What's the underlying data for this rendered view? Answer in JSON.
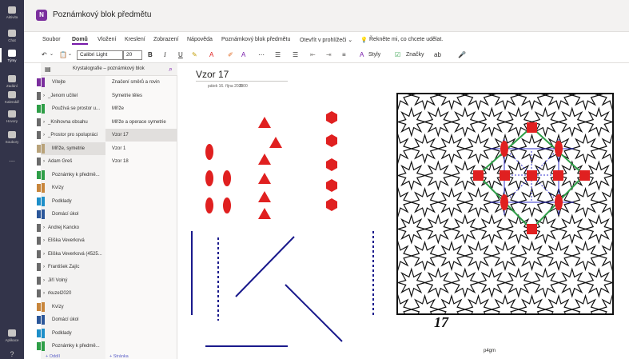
{
  "rail": [
    {
      "label": "Aktivita",
      "icon": "bell-icon"
    },
    {
      "label": "Chat",
      "icon": "chat-icon"
    },
    {
      "label": "Týmy",
      "icon": "teams-icon",
      "active": true
    },
    {
      "label": "Zadání",
      "icon": "assignments-icon"
    },
    {
      "label": "Kalendář",
      "icon": "calendar-icon"
    },
    {
      "label": "Hovory",
      "icon": "phone-icon"
    },
    {
      "label": "Soubory",
      "icon": "files-icon"
    },
    {
      "label": "...",
      "icon": "more-icon"
    },
    {
      "label": "Aplikace",
      "icon": "apps-icon"
    },
    {
      "label": "?",
      "icon": "help-icon"
    }
  ],
  "app": {
    "icon_letter": "N",
    "title": "Poznámkový blok předmětu"
  },
  "menu": [
    "Soubor",
    "Domů",
    "Vložení",
    "Kreslení",
    "Zobrazení",
    "Nápověda",
    "Poznámkový blok předmětu",
    "Otevřít v prohlížeči",
    "Řekněte mi, co chcete udělat."
  ],
  "toolbar": {
    "font": "Calibri Light",
    "size": "20",
    "bold": "B",
    "italic": "I",
    "underline": "U",
    "styles": "Styly",
    "tags": "Značky"
  },
  "notebook": {
    "title": "Krystalografie – poznámkový blok"
  },
  "sections": [
    {
      "label": "Vítejte",
      "color": "#7b2f9e"
    },
    {
      "label": "_Jenom učitel",
      "color": "",
      "group": true
    },
    {
      "label": "Používá se prostor u...",
      "color": "#2e9e47"
    },
    {
      "label": "_Knihovna obsahu",
      "color": "",
      "group": true
    },
    {
      "label": "_Prostor pro spolupráci",
      "color": "",
      "group": true
    },
    {
      "label": "Mříže, symetrie",
      "color": "#b9a37a",
      "active": true
    },
    {
      "label": "Adam Greš",
      "color": "",
      "group": true
    },
    {
      "label": "Poznámky k předmě...",
      "color": "#2e9e47"
    },
    {
      "label": "Kvízy",
      "color": "#c8863c"
    },
    {
      "label": "Podklady",
      "color": "#1e8fc9"
    },
    {
      "label": "Domácí úkol",
      "color": "#2b579a"
    },
    {
      "label": "Andrej Kancko",
      "color": "",
      "group": true
    },
    {
      "label": "Eliška Veverková",
      "color": "",
      "group": true
    },
    {
      "label": "Eliška Veverková (4525...",
      "color": "",
      "group": true
    },
    {
      "label": "František Zajíc",
      "color": "",
      "group": true
    },
    {
      "label": "Jiří Volný",
      "color": "",
      "group": true
    },
    {
      "label": "rkuzel2020",
      "color": "",
      "group": true
    },
    {
      "label": "Kvízy",
      "color": "#c8863c"
    },
    {
      "label": "Domácí úkol",
      "color": "#2b579a"
    },
    {
      "label": "Podklady",
      "color": "#1e8fc9"
    },
    {
      "label": "Poznámky k předmě...",
      "color": "#2e9e47"
    }
  ],
  "pages": [
    {
      "label": "Značení směrů a rovin"
    },
    {
      "label": "Symetrie těles"
    },
    {
      "label": "Mříže"
    },
    {
      "label": "Mříže a operace symetrie"
    },
    {
      "label": "Vzor 17",
      "active": true
    },
    {
      "label": "Vzor 1"
    },
    {
      "label": "Vzor 18"
    }
  ],
  "add_section": "+ Oddíl",
  "add_page": "+ Stránka",
  "page": {
    "title": "Vzor 17",
    "date": "pátek 16. října 2020",
    "time": "0:00",
    "image_number": "17",
    "caption": "p4gm"
  },
  "colors": {
    "accent": "#7719aa",
    "rail": "#33344a",
    "shape": "#e02020",
    "line": "#1a1a8c"
  }
}
